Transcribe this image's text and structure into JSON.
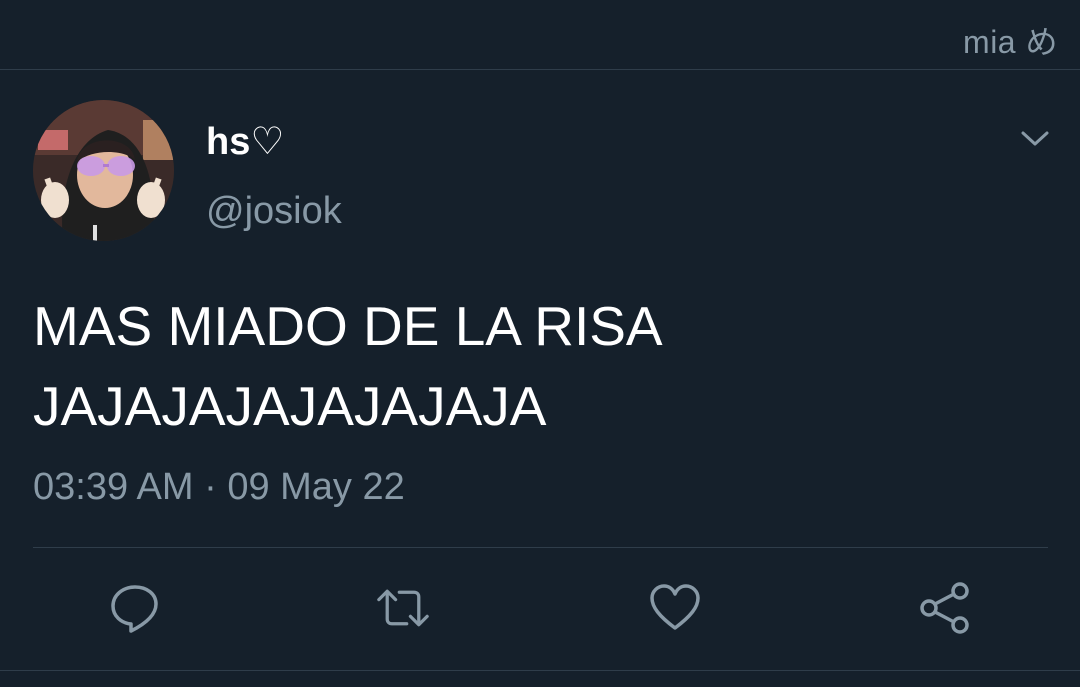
{
  "header": {
    "account_name": "mia め"
  },
  "tweet": {
    "display_name": "hs♡",
    "handle": "@josiok",
    "text_lines": [
      "MAS MIADO DE LA RISA",
      "JAJAJAJAJAJAJAJA"
    ],
    "timestamp": "03:39 AM · 09 May 22"
  },
  "icons": {
    "more": "chevron-down-icon",
    "reply": "reply-icon",
    "retweet": "retweet-icon",
    "like": "heart-icon",
    "share": "share-icon"
  },
  "colors": {
    "background": "#15202b",
    "secondary_text": "#8899a6",
    "primary_text": "#ffffff",
    "divider": "#2f3d4a"
  }
}
